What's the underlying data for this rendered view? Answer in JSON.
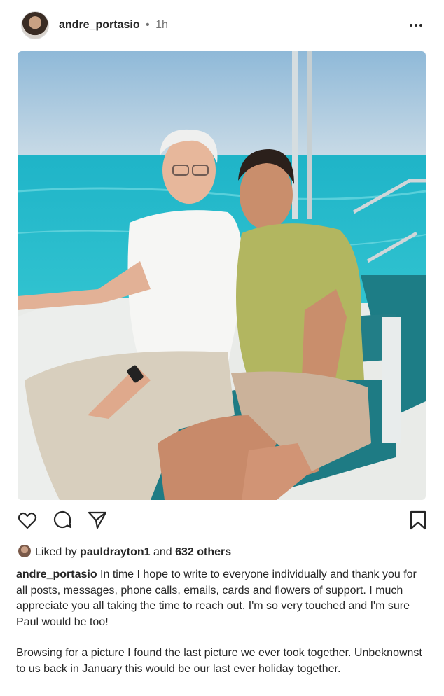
{
  "post": {
    "username": "andre_portasio",
    "separator": "•",
    "time": "1h"
  },
  "icons": {
    "more": "more-horizontal-icon",
    "like": "heart-icon",
    "comment": "comment-icon",
    "share": "send-icon",
    "save": "bookmark-icon"
  },
  "likes": {
    "prefix": "Liked by",
    "user": "pauldrayton1",
    "conjunction": "and",
    "others": "632 others"
  },
  "caption": {
    "username": "andre_portasio",
    "paragraph1": "In time I hope to write to everyone individually and thank you for all posts, messages, phone calls, emails, cards and flowers of support. I much appreciate you all taking the time to reach out. I'm so very touched and I'm sure Paul would be too!",
    "paragraph2": "Browsing for a picture I found the last picture we ever took together. Unbeknownst to us back in January this would be our last ever holiday together."
  },
  "colors": {
    "text": "#262626",
    "muted": "#737373",
    "sea": "#2ec4d0",
    "sky": "#a9c7dd"
  }
}
